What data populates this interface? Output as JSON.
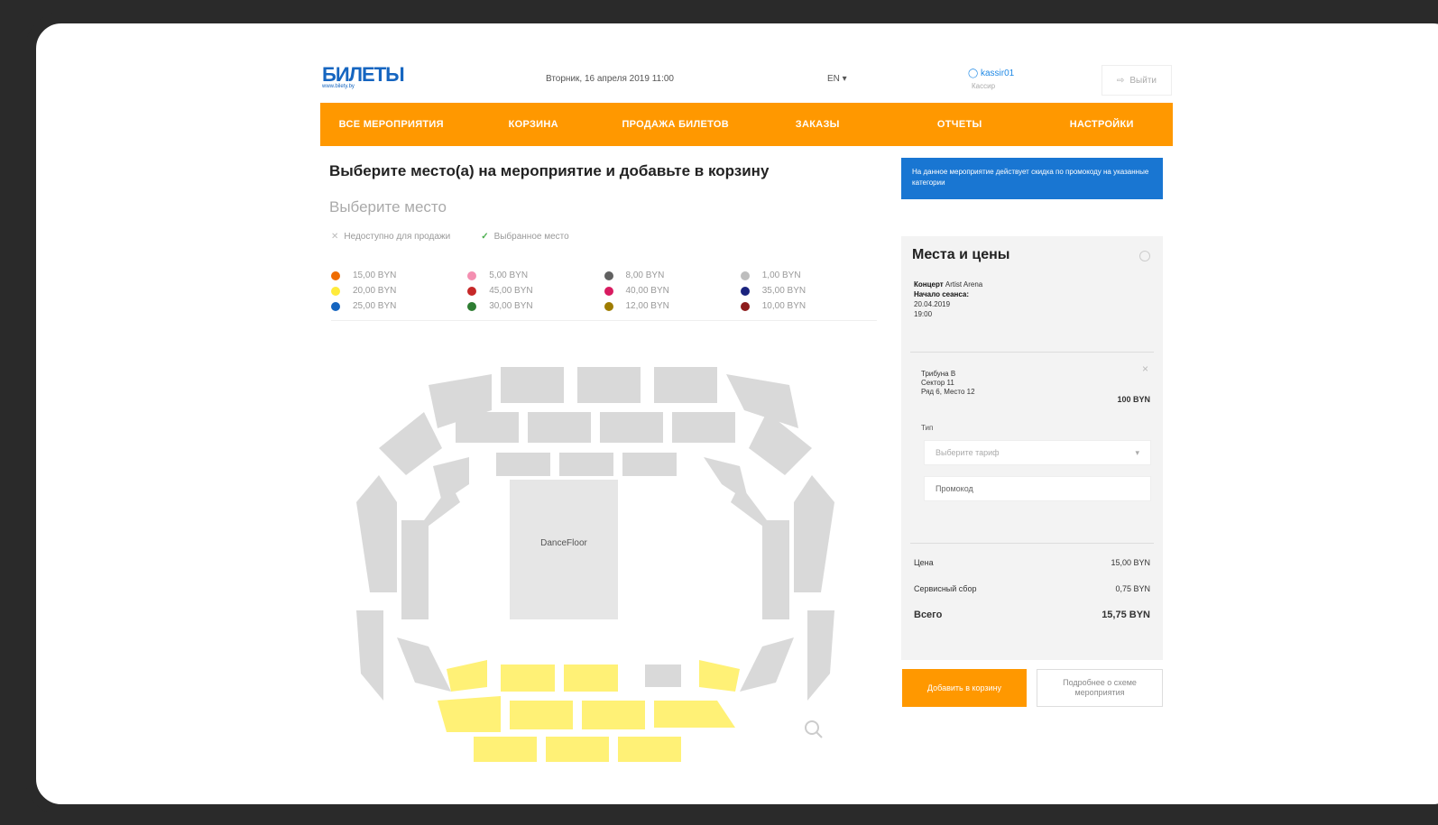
{
  "logo": {
    "text": "БИЛЕТЫ",
    "sub": "www.bilety.by"
  },
  "header": {
    "date": "Вторник, 16 апреля 2019   11:00",
    "lang": "EN ▾",
    "user": "kassir01",
    "user_sub": "Кассир",
    "logout": "Выйти"
  },
  "nav": [
    "Все мероприятия",
    "Корзина",
    "Продажа билетов",
    "Заказы",
    "Отчеты",
    "Настройки"
  ],
  "main": {
    "title": "Выберите место(а) на мероприятие и добавьте в корзину",
    "subtitle": "Выберите место",
    "legend_unavailable": "Недоступно для продажи",
    "legend_selected": "Выбранное место"
  },
  "price_legend": [
    {
      "label": "15,00 BYN",
      "color": "#ef6c00"
    },
    {
      "label": "5,00 BYN",
      "color": "#f48fb1"
    },
    {
      "label": "8,00 BYN",
      "color": "#616161"
    },
    {
      "label": "1,00 BYN",
      "color": "#bdbdbd"
    },
    {
      "label": "20,00 BYN",
      "color": "#ffeb3b"
    },
    {
      "label": "45,00 BYN",
      "color": "#c62828"
    },
    {
      "label": "40,00 BYN",
      "color": "#d81b60"
    },
    {
      "label": "35,00 BYN",
      "color": "#1a237e"
    },
    {
      "label": "25,00 BYN",
      "color": "#1565c0"
    },
    {
      "label": "30,00 BYN",
      "color": "#2e7d32"
    },
    {
      "label": "12,00 BYN",
      "color": "#9e7c00"
    },
    {
      "label": "10,00 BYN",
      "color": "#8d1c1c"
    }
  ],
  "arena": {
    "stage_label": "DanceFloor"
  },
  "info_box": "На данное мероприятие действует скидка по промокоду на указанные категории",
  "panel": {
    "title": "Места и цены",
    "event_label": "Концерт",
    "event_value": "Artist Arena",
    "date_label": "Начало сеанса:",
    "date_value": "20.04.2019",
    "time_value": "19:00",
    "ticket_lines": [
      "Трибуна В",
      "Сектор 11",
      "Ряд 6, Место 12"
    ],
    "ticket_price": "100 BYN",
    "type_label": "Тип",
    "select_placeholder": "Выберите тариф",
    "promo_value": "Промокод",
    "price_label": "Цена",
    "price_value": "15,00 BYN",
    "fee_label": "Сервисный сбор",
    "fee_value": "0,75 BYN",
    "total_label": "Всего",
    "total_value": "15,75 BYN"
  },
  "buttons": {
    "add": "Добавить в корзину",
    "more": "Подробнее о схеме мероприятия"
  }
}
